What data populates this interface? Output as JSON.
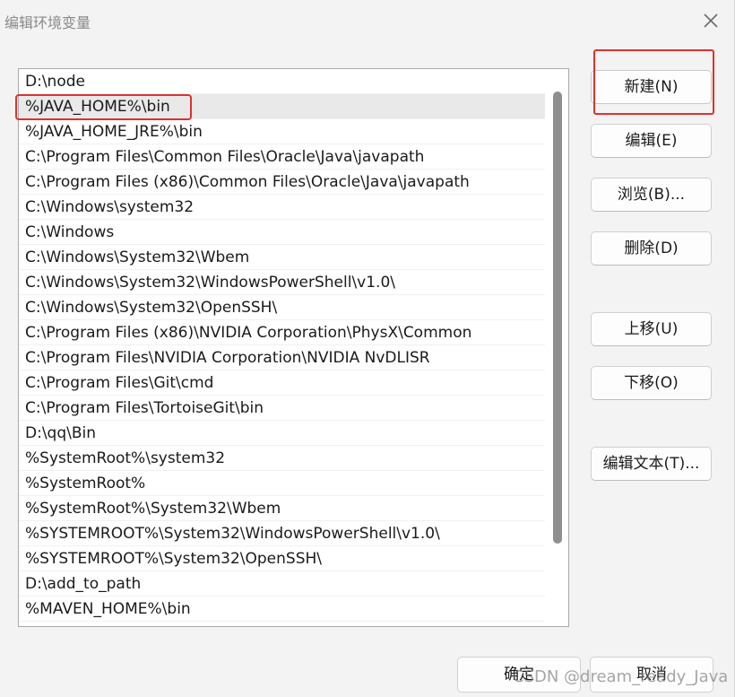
{
  "window": {
    "title": "编辑环境变量",
    "close_symbol": "✕"
  },
  "list": {
    "selected_index": 1,
    "items": [
      "D:\\node",
      "%JAVA_HOME%\\bin",
      "%JAVA_HOME_JRE%\\bin",
      "C:\\Program Files\\Common Files\\Oracle\\Java\\javapath",
      "C:\\Program Files (x86)\\Common Files\\Oracle\\Java\\javapath",
      "C:\\Windows\\system32",
      "C:\\Windows",
      "C:\\Windows\\System32\\Wbem",
      "C:\\Windows\\System32\\WindowsPowerShell\\v1.0\\",
      "C:\\Windows\\System32\\OpenSSH\\",
      "C:\\Program Files (x86)\\NVIDIA Corporation\\PhysX\\Common",
      "C:\\Program Files\\NVIDIA Corporation\\NVIDIA NvDLISR",
      "C:\\Program Files\\Git\\cmd",
      "C:\\Program Files\\TortoiseGit\\bin",
      "D:\\qq\\Bin",
      "%SystemRoot%\\system32",
      "%SystemRoot%",
      "%SystemRoot%\\System32\\Wbem",
      "%SYSTEMROOT%\\System32\\WindowsPowerShell\\v1.0\\",
      "%SYSTEMROOT%\\System32\\OpenSSH\\",
      "D:\\add_to_path",
      "%MAVEN_HOME%\\bin"
    ]
  },
  "buttons": {
    "new": "新建(N)",
    "edit": "编辑(E)",
    "browse": "浏览(B)...",
    "delete": "删除(D)",
    "move_up": "上移(U)",
    "move_down": "下移(O)",
    "edit_text": "编辑文本(T)..."
  },
  "footer": {
    "ok": "确定",
    "cancel": "取消"
  },
  "watermark": "CSDN @dream_ready_Java",
  "colors": {
    "annotation_red": "#e0302f",
    "selected_row": "#e9e9e9",
    "scrollbar": "#8f8f8f"
  }
}
